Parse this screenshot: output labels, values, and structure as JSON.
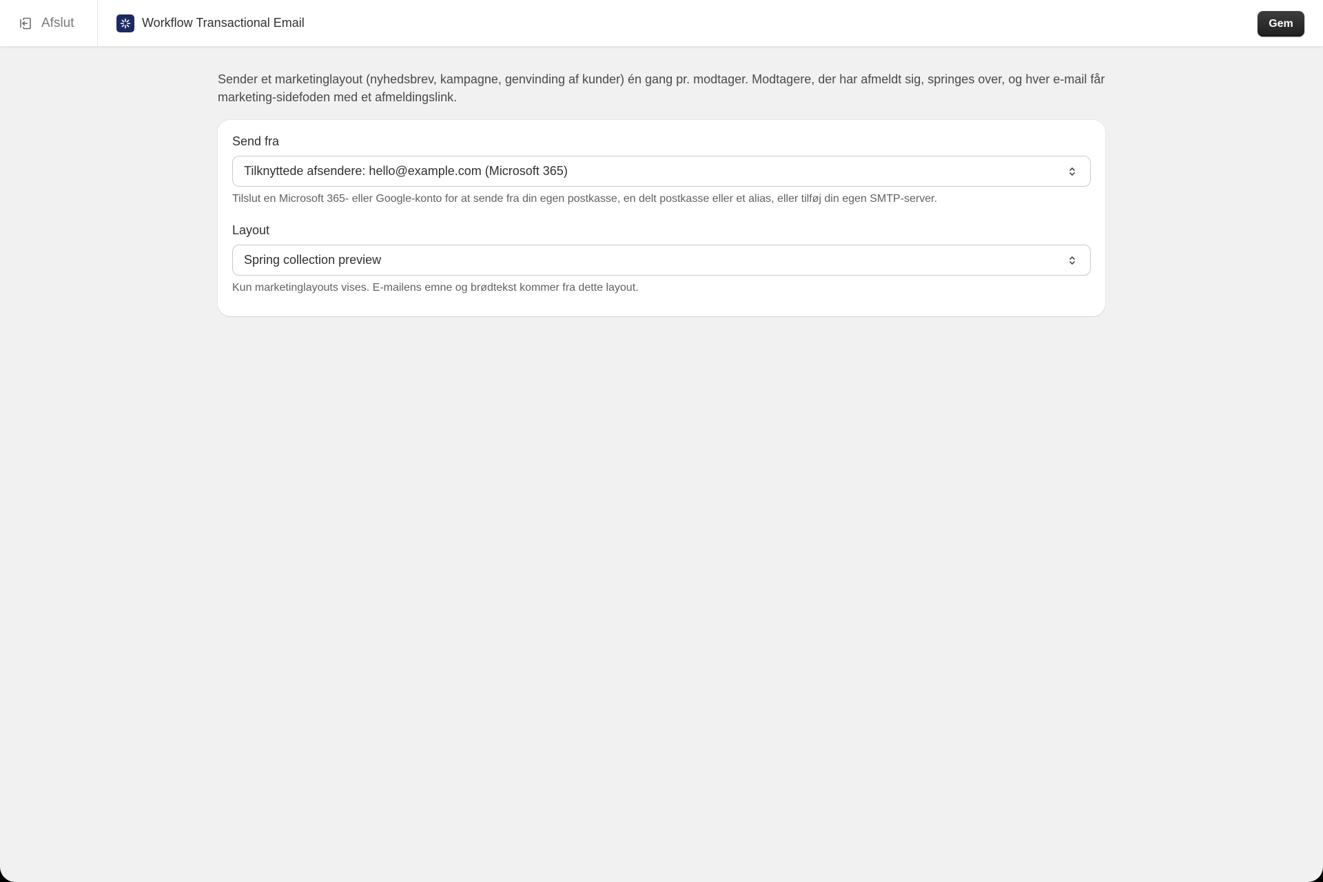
{
  "header": {
    "exit_label": "Afslut",
    "app_title": "Workflow Transactional Email",
    "save_label": "Gem"
  },
  "main": {
    "intro": "Sender et marketinglayout (nyhedsbrev, kampagne, genvinding af kunder) én gang pr. modtager. Modtagere, der har afmeldt sig, springes over, og hver e-mail får marketing-sidefoden med et afmeldingslink.",
    "send_from": {
      "label": "Send fra",
      "value": "Tilknyttede afsendere: hello@example.com (Microsoft 365)",
      "help": "Tilslut en Microsoft 365- eller Google-konto for at sende fra din egen postkasse, en delt postkasse eller et alias, eller tilføj din egen SMTP-server."
    },
    "layout": {
      "label": "Layout",
      "value": "Spring collection preview",
      "help": "Kun marketinglayouts vises. E-mailens emne og brødtekst kommer fra dette layout."
    }
  },
  "icons": {
    "exit": "exit-icon",
    "app_logo": "sparkle-logo-icon",
    "select_chevron": "chevron-up-down-icon"
  },
  "colors": {
    "page_background": "#f1f1f1",
    "logo_background": "#1c2a63",
    "save_button": "#303030"
  }
}
